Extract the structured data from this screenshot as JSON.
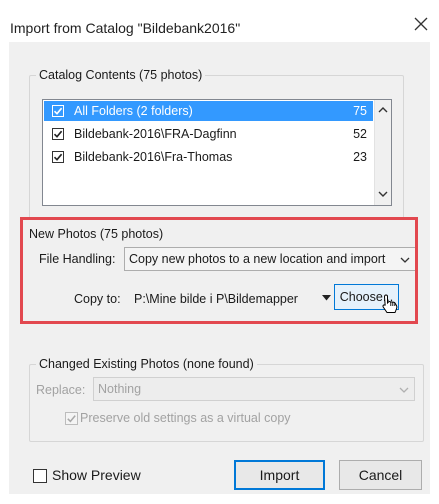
{
  "dialog": {
    "title": "Import from Catalog \"Bildebank2016\"",
    "close_icon": "close-icon"
  },
  "catalog_contents": {
    "title": "Catalog Contents (75 photos)",
    "rows": [
      {
        "label": "All Folders (2 folders)",
        "count": "75",
        "checked": true,
        "selected": true
      },
      {
        "label": "Bildebank-2016\\FRA-Dagfinn",
        "count": "52",
        "checked": true,
        "selected": false
      },
      {
        "label": "Bildebank-2016\\Fra-Thomas",
        "count": "23",
        "checked": true,
        "selected": false
      }
    ]
  },
  "new_photos": {
    "title": "New Photos (75 photos)",
    "file_handling_label": "File Handling:",
    "file_handling_value": "Copy new photos to a new location and import",
    "copy_to_label": "Copy to:",
    "copy_to_value": "P:\\Mine bilde i P\\Bildemapper",
    "choose_label": "Choose..."
  },
  "changed_photos": {
    "title": "Changed Existing Photos (none found)",
    "replace_label": "Replace:",
    "replace_value": "Nothing",
    "preserve_label": "Preserve old settings as a virtual copy",
    "preserve_checked": true
  },
  "footer": {
    "show_preview_label": "Show Preview",
    "show_preview_checked": false,
    "import_label": "Import",
    "cancel_label": "Cancel"
  },
  "colors": {
    "selection": "#3399ff",
    "highlight_border": "#e2484f",
    "primary_border": "#0078d7"
  }
}
